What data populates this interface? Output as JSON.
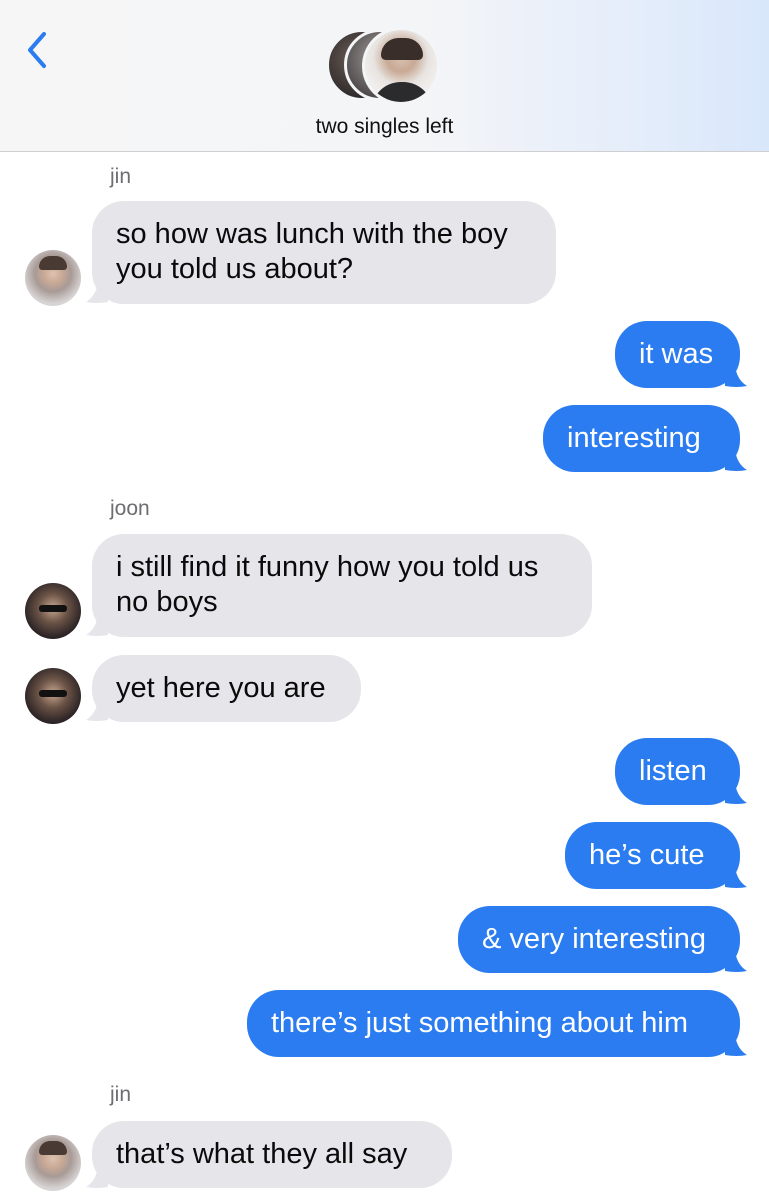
{
  "header": {
    "title": "two singles left",
    "back_icon": "chevron-left-icon",
    "accent_color": "#2a7cf0"
  },
  "colors": {
    "incoming_bubble": "#e5e5ea",
    "outgoing_bubble": "#2a7cf0",
    "sender_label": "#6d6d72"
  },
  "messages": [
    {
      "type": "sender",
      "text": "jin"
    },
    {
      "type": "in",
      "sender": "jin",
      "lines": [
        "so how was lunch with the boy",
        "you told us about?"
      ]
    },
    {
      "type": "out",
      "text": "it was"
    },
    {
      "type": "out",
      "text": "interesting"
    },
    {
      "type": "sender",
      "text": "joon"
    },
    {
      "type": "in",
      "sender": "joon",
      "lines": [
        "i still find it funny how you told us",
        "no boys"
      ]
    },
    {
      "type": "in",
      "sender": "joon",
      "lines": [
        "yet here you are"
      ]
    },
    {
      "type": "out",
      "text": "listen"
    },
    {
      "type": "out",
      "text": "he’s cute"
    },
    {
      "type": "out",
      "text": "& very interesting"
    },
    {
      "type": "out",
      "text": "there’s just something about him"
    },
    {
      "type": "sender",
      "text": "jin"
    },
    {
      "type": "in",
      "sender": "jin",
      "lines": [
        "that’s what they all say"
      ]
    }
  ]
}
